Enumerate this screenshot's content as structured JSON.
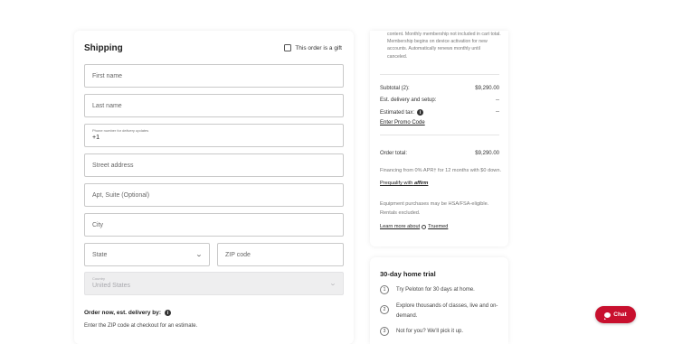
{
  "shipping": {
    "title": "Shipping",
    "gift_label": "This order is a gift",
    "first_name_placeholder": "First name",
    "last_name_placeholder": "Last name",
    "phone_label": "Phone number for delivery updates",
    "phone_value": "+1",
    "street_placeholder": "Street address",
    "apt_placeholder": "Apt, Suite (Optional)",
    "city_placeholder": "City",
    "state_placeholder": "State",
    "zip_placeholder": "ZIP code",
    "country_label": "Country",
    "country_value": "United States",
    "estimate_title": "Order now, est. delivery by:",
    "estimate_sub": "Enter the ZIP code at checkout for an estimate."
  },
  "summary": {
    "membership_note": "content. Monthly membership not included in cart total. Membership begins on device activation for new accounts. Automatically renews monthly until canceled.",
    "subtotal_label": "Subtotal (2):",
    "subtotal_value": "$9,290.00",
    "delivery_label": "Est. delivery and setup:",
    "delivery_value": "--",
    "tax_label": "Estimated tax:",
    "tax_value": "--",
    "promo_link": "Enter Promo Code",
    "order_total_label": "Order total:",
    "order_total_value": "$9,290.00",
    "financing_text": "Financing from 0% APR† for 12 months with $0 down.",
    "prequalify_link": "Prequalify with",
    "affirm_logo": "affirm",
    "hsa_text": "Equipment purchases may be HSA/FSA-eligible. Rentals excluded.",
    "learn_more": "Learn more about",
    "truemed_logo": "Truemed"
  },
  "trial": {
    "title": "30-day home trial",
    "steps": [
      {
        "num": "1",
        "text": "Try Peloton for 30 days at home."
      },
      {
        "num": "2",
        "text": "Explore thousands of classes, live and on-demand."
      },
      {
        "num": "3",
        "text": "Not for you? We'll pick it up."
      }
    ]
  },
  "chat": {
    "label": "Chat"
  },
  "colors": {
    "accent": "#c8102e",
    "disabled_bg": "#eeeeef"
  }
}
